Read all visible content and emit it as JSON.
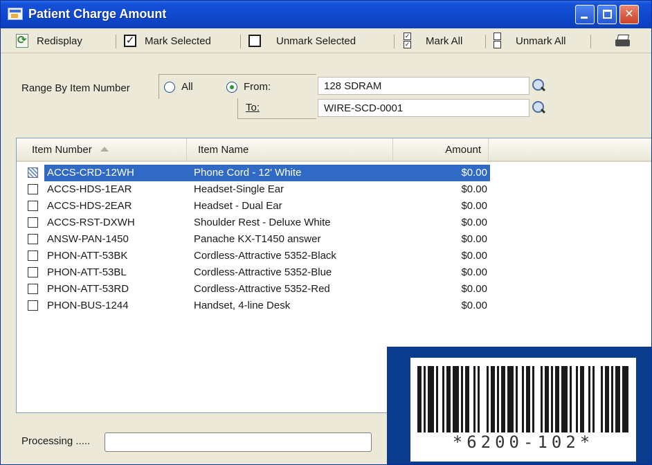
{
  "window": {
    "title": "Patient Charge Amount",
    "controls": {
      "minimize": "",
      "maximize": "",
      "close": "✕"
    }
  },
  "toolbar": {
    "redisplay_label": "Redisplay",
    "mark_selected_label": "Mark Selected",
    "unmark_selected_label": "Unmark Selected",
    "mark_all_label": "Mark All",
    "unmark_all_label": "Unmark All",
    "icons": [
      "redisplay-icon",
      "checked-box-icon",
      "empty-box-icon",
      "mark-all-icon",
      "unmark-all-icon",
      "printer-icon"
    ]
  },
  "range": {
    "label": "Range By Item Number",
    "option_all": "All",
    "option_from": "From:",
    "selected": "From:",
    "to_label": "To:",
    "from_value": "128 SDRAM",
    "to_value": "WIRE-SCD-0001"
  },
  "grid": {
    "columns": [
      "Item Number",
      "Item Name",
      "Amount"
    ],
    "sorted_column": "Item Number",
    "rows": [
      {
        "item_number": "ACCS-CRD-12WH",
        "item_name": "Phone Cord - 12' White",
        "amount": "$0.00",
        "selected": true
      },
      {
        "item_number": "ACCS-HDS-1EAR",
        "item_name": "Headset-Single Ear",
        "amount": "$0.00",
        "selected": false
      },
      {
        "item_number": "ACCS-HDS-2EAR",
        "item_name": "Headset - Dual Ear",
        "amount": "$0.00",
        "selected": false
      },
      {
        "item_number": "ACCS-RST-DXWH",
        "item_name": "Shoulder Rest - Deluxe White",
        "amount": "$0.00",
        "selected": false
      },
      {
        "item_number": "ANSW-PAN-1450",
        "item_name": "Panache KX-T1450 answer",
        "amount": "$0.00",
        "selected": false
      },
      {
        "item_number": "PHON-ATT-53BK",
        "item_name": "Cordless-Attractive 5352-Black",
        "amount": "$0.00",
        "selected": false
      },
      {
        "item_number": "PHON-ATT-53BL",
        "item_name": "Cordless-Attractive 5352-Blue",
        "amount": "$0.00",
        "selected": false
      },
      {
        "item_number": "PHON-ATT-53RD",
        "item_name": "Cordless-Attractive 5352-Red",
        "amount": "$0.00",
        "selected": false
      },
      {
        "item_number": "PHON-BUS-1244",
        "item_name": "Handset, 4-line Desk",
        "amount": "$0.00",
        "selected": false
      }
    ]
  },
  "status": {
    "processing_label": "Processing .....",
    "progress": 0
  },
  "barcode": {
    "text": "*6200-102*"
  },
  "colors": {
    "title_bar": "#0f49d0",
    "selection": "#316ac5",
    "window_bg": "#ece9d8",
    "barcode_panel": "#0b3b8c"
  }
}
